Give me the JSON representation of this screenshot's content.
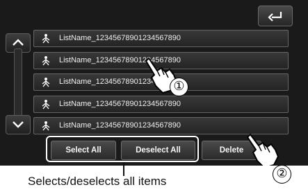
{
  "list": {
    "rows": [
      {
        "label": "ListName_12345678901234567890"
      },
      {
        "label": "ListName_12345678901234567890"
      },
      {
        "label": "ListName_12345678901234567890"
      },
      {
        "label": "ListName_12345678901234567890"
      },
      {
        "label": "ListName_12345678901234567890"
      }
    ]
  },
  "toolbar": {
    "select_all_label": "Select All",
    "deselect_all_label": "Deselect All",
    "delete_label": "Delete"
  },
  "annotations": {
    "step_1": "①",
    "step_2": "②",
    "caption": "Selects/deselects all items"
  },
  "icons": {
    "back": "back-arrow-icon",
    "scroll_up": "chevron-up-icon",
    "scroll_down": "chevron-down-icon",
    "row": "person-icon",
    "hand": "pointing-hand-icon"
  },
  "colors": {
    "screen_bg": "#1a1a1a",
    "row_bg": "#2e2e2e",
    "text": "#f0f0f0",
    "callout": "#ffffff"
  }
}
